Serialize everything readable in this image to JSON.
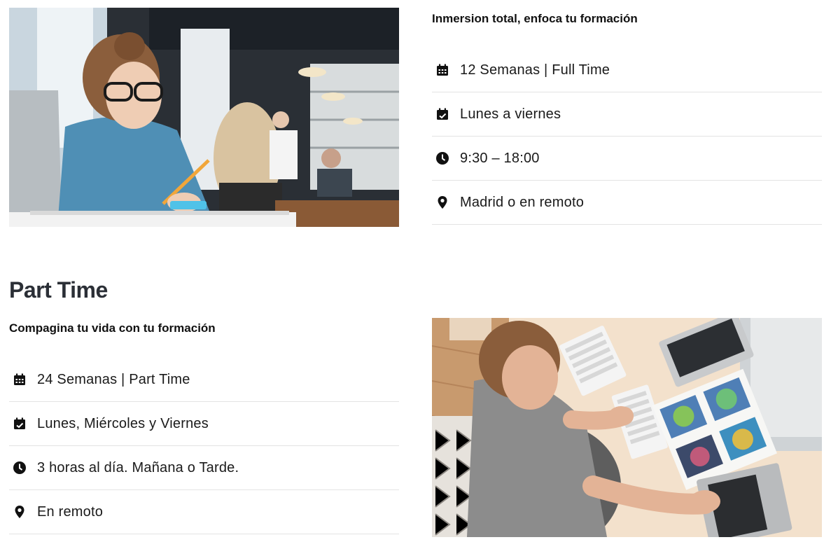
{
  "full_time": {
    "subtitle": "Inmersion total, enfoca tu formación",
    "items": [
      {
        "icon": "calendar-icon",
        "text": "12 Semanas | Full Time"
      },
      {
        "icon": "calendar-check-icon",
        "text": "Lunes a viernes"
      },
      {
        "icon": "clock-icon",
        "text": "9:30 – 18:00"
      },
      {
        "icon": "location-pin-icon",
        "text": "Madrid o en remoto"
      }
    ]
  },
  "part_time": {
    "title": "Part Time",
    "subtitle": "Compagina tu vida con tu formación",
    "items": [
      {
        "icon": "calendar-icon",
        "text": "24 Semanas | Part Time"
      },
      {
        "icon": "calendar-check-icon",
        "text": "Lunes, Miércoles y Viernes"
      },
      {
        "icon": "clock-icon",
        "text": "3 horas al día. Mañana o Tarde."
      },
      {
        "icon": "location-pin-icon",
        "text": "En remoto"
      }
    ]
  },
  "colors": {
    "icon": "#111111",
    "divider": "#e3e3e3",
    "title": "#2b2f36"
  }
}
